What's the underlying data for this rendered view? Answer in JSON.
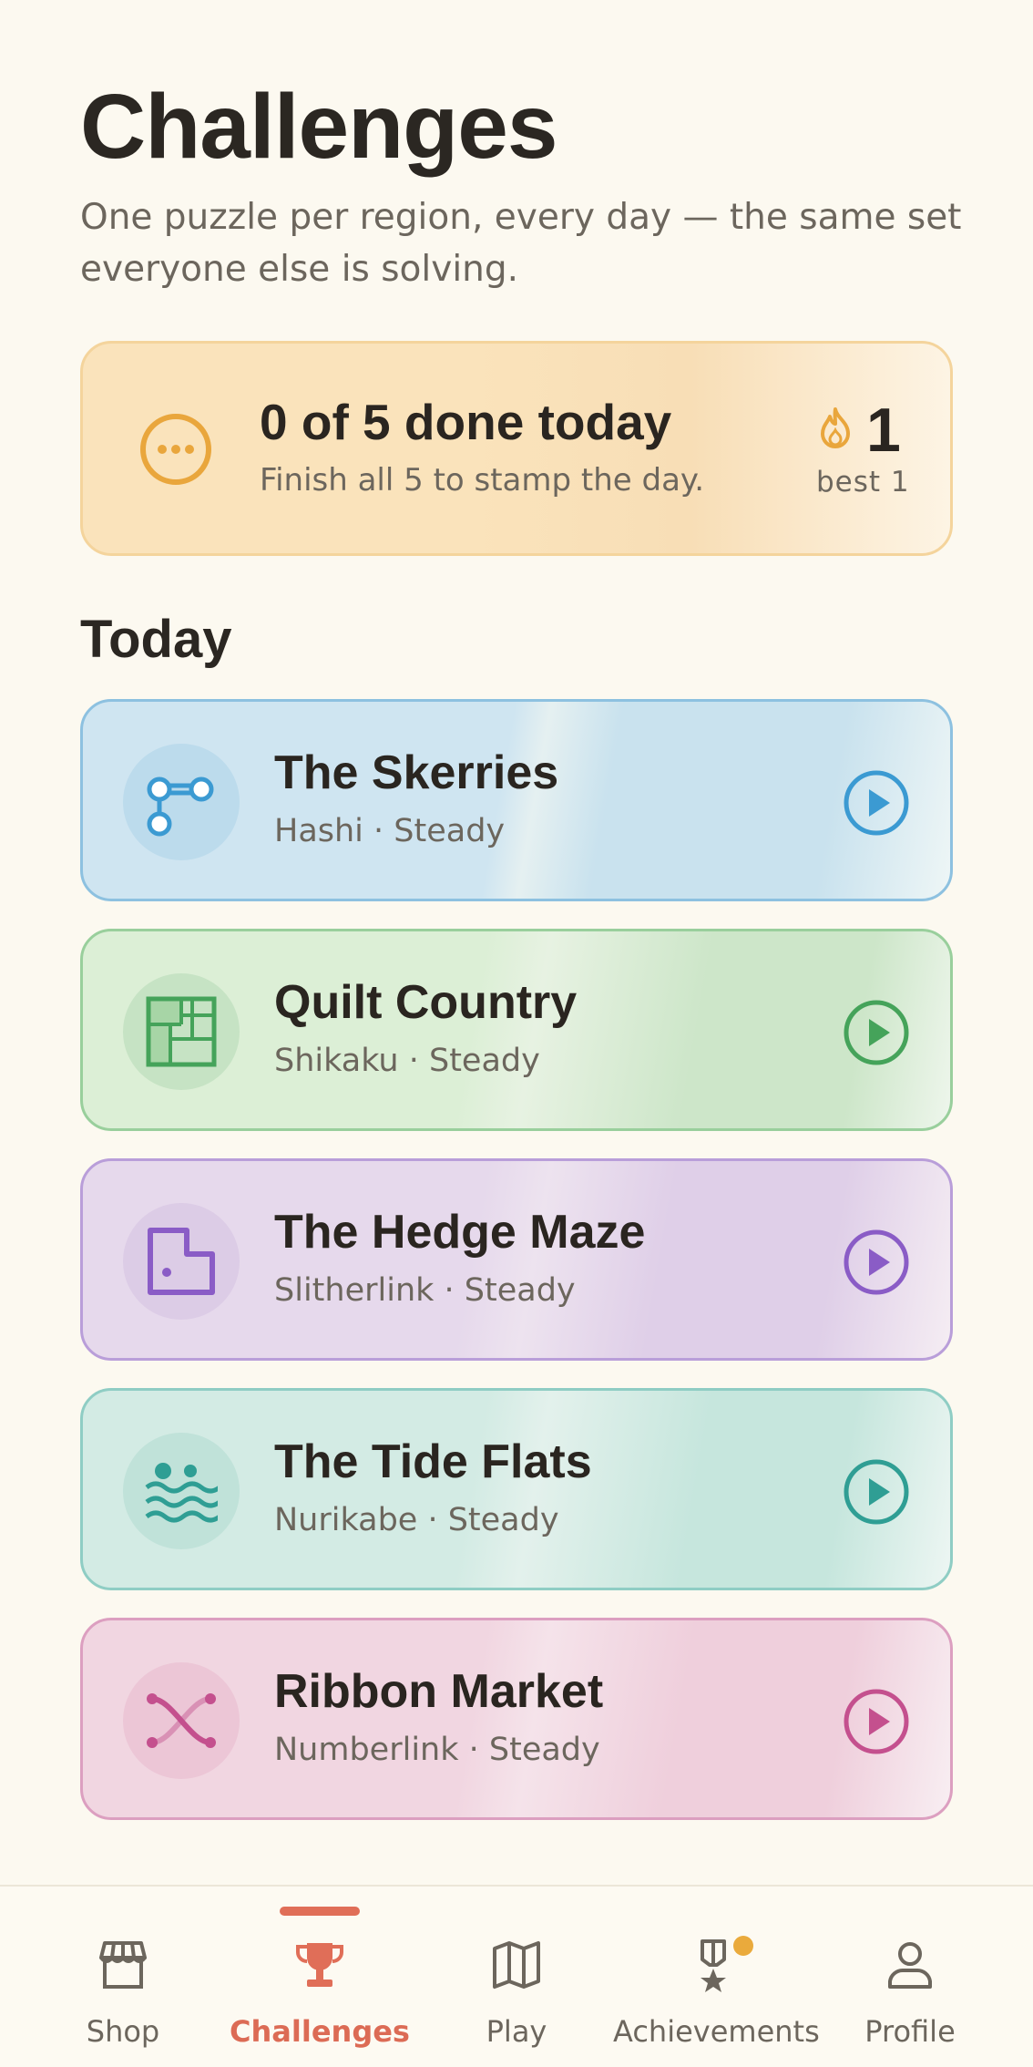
{
  "header": {
    "title": "Challenges",
    "subtitle": "One puzzle per region, every day — the same set everyone else is solving."
  },
  "summary": {
    "title": "0 of 5 done today",
    "subtitle": "Finish all 5 to stamp the day.",
    "status_icon": "ellipsis-circle-icon",
    "streak_icon": "flame-icon",
    "streak_count": "1",
    "best_label": "best 1",
    "accent": "#e9a63c"
  },
  "section": {
    "title": "Today"
  },
  "challenges": [
    {
      "title": "The Skerries",
      "subtitle": "Hashi · Steady",
      "icon": "bridges-icon",
      "color": "#3b9ad2",
      "bg": "#cde4f1",
      "border": "#8dc1e0"
    },
    {
      "title": "Quilt Country",
      "subtitle": "Shikaku · Steady",
      "icon": "quilt-grid-icon",
      "color": "#45a35a",
      "bg": "#d4ebcf",
      "border": "#99cf9c"
    },
    {
      "title": "The Hedge Maze",
      "subtitle": "Slitherlink · Steady",
      "icon": "loop-path-icon",
      "color": "#8a5cc6",
      "bg": "#e2d5eb",
      "border": "#b99ed9"
    },
    {
      "title": "The Tide Flats",
      "subtitle": "Nurikabe · Steady",
      "icon": "islands-waves-icon",
      "color": "#2f9e94",
      "bg": "#cae8e0",
      "border": "#8fcdc4"
    },
    {
      "title": "Ribbon Market",
      "subtitle": "Numberlink · Steady",
      "icon": "crossed-ribbons-icon",
      "color": "#c4508e",
      "bg": "#efd0dd",
      "border": "#dc9fc0"
    }
  ],
  "nav": {
    "items": [
      {
        "label": "Shop",
        "icon": "shop-icon"
      },
      {
        "label": "Challenges",
        "icon": "trophy-icon",
        "active": true
      },
      {
        "label": "Play",
        "icon": "map-icon"
      },
      {
        "label": "Achievements",
        "icon": "medal-icon",
        "badge": true
      },
      {
        "label": "Profile",
        "icon": "person-icon"
      }
    ],
    "active_color": "#dc6b55"
  }
}
